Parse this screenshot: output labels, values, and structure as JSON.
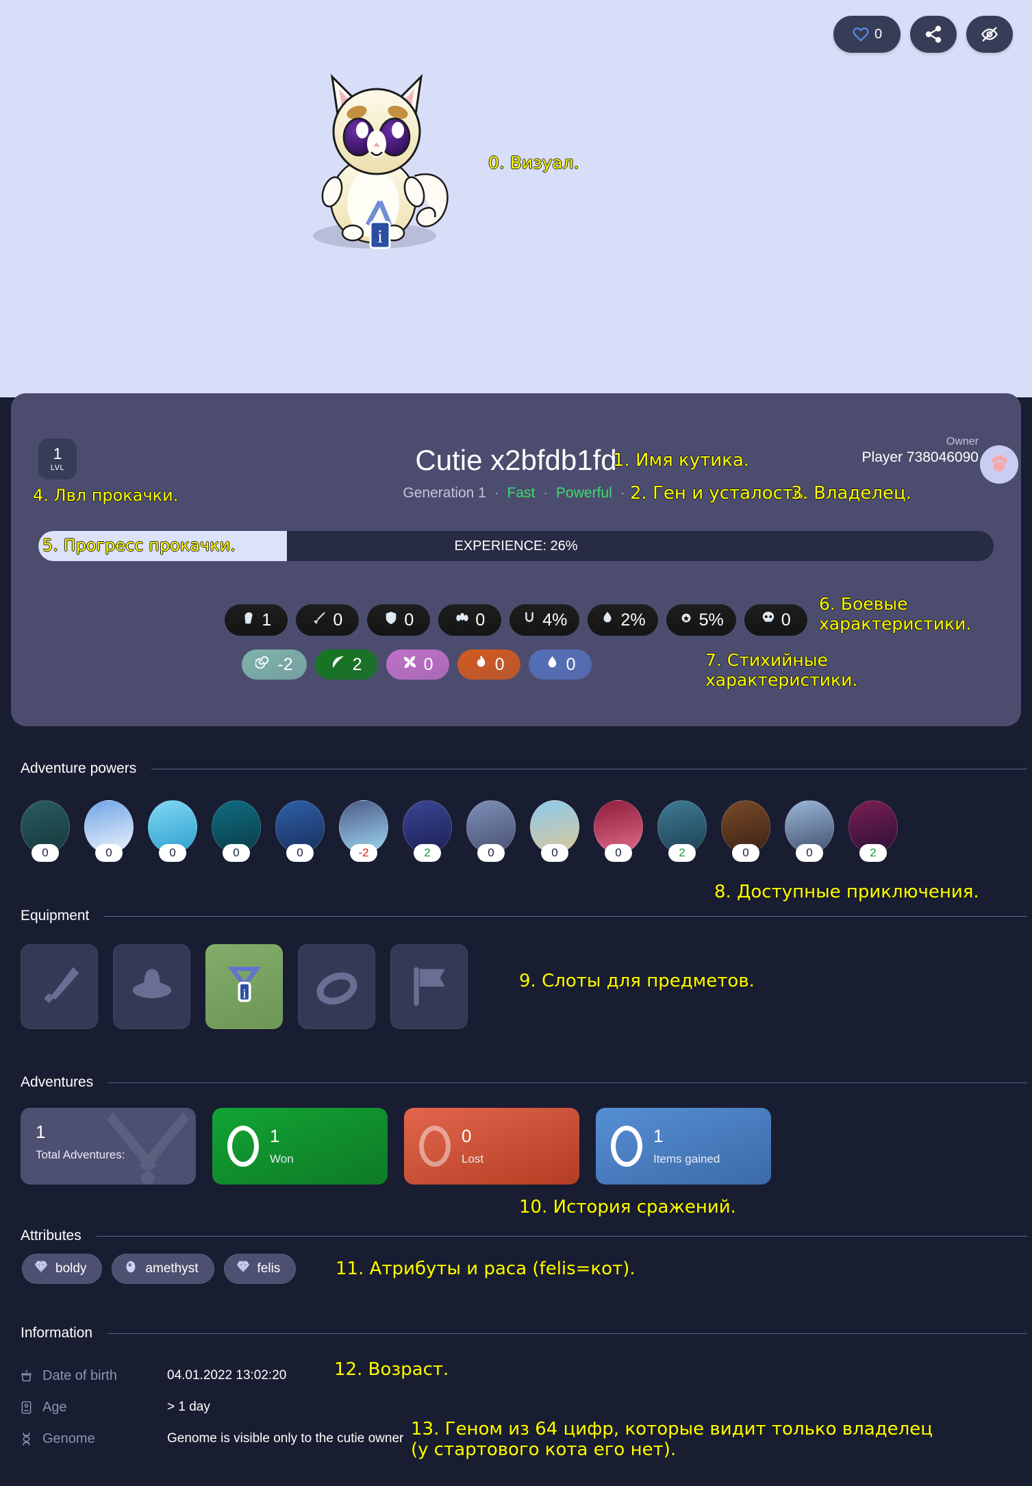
{
  "topbar": {
    "like_count": "0",
    "like_icon": "heart-icon",
    "share_icon": "share-icon",
    "hide_icon": "eye-off-icon"
  },
  "hero": {
    "visual_annotation": "0. Визуал.",
    "avatar_name": "cutie-cat-avatar"
  },
  "profile": {
    "level_value": "1",
    "level_label": "LVL",
    "title": "Cutie x2bfdb1fd",
    "generation": "Generation 1",
    "trait_speed": "Fast",
    "trait_power": "Powerful",
    "separator": "·",
    "owner_label": "Owner",
    "owner_name": "Player 738046090",
    "owner_avatar_icon": "paw-icon",
    "experience_label": "EXPERIENCE: 26%",
    "experience_percent": 26
  },
  "battle_stats": [
    {
      "icon": "fist-icon",
      "value": "1"
    },
    {
      "icon": "sword-icon",
      "value": "0"
    },
    {
      "icon": "shield-icon",
      "value": "0"
    },
    {
      "icon": "paws-icon",
      "value": "0"
    },
    {
      "icon": "horseshoe-icon",
      "value": "4%"
    },
    {
      "icon": "potion-icon",
      "value": "2%"
    },
    {
      "icon": "medal-icon",
      "value": "5%"
    },
    {
      "icon": "skull-icon",
      "value": "0"
    }
  ],
  "elemental_stats": [
    {
      "icon": "spiral-icon",
      "value": "-2",
      "color": "#7fb3ac"
    },
    {
      "icon": "leaf-icon",
      "value": "2",
      "color": "#14761f"
    },
    {
      "icon": "wind-icon",
      "value": "0",
      "color": "#c070c8"
    },
    {
      "icon": "fire-icon",
      "value": "0",
      "color": "#d35a20"
    },
    {
      "icon": "water-icon",
      "value": "0",
      "color": "#5570b9"
    }
  ],
  "sections": {
    "adventure_powers": "Adventure powers",
    "equipment": "Equipment",
    "adventures": "Adventures",
    "attributes": "Attributes",
    "information": "Information"
  },
  "adventure_powers": [
    {
      "name": "cave",
      "value": "0",
      "c1": "#2c5b5e",
      "c2": "#14393d"
    },
    {
      "name": "snowfield",
      "value": "0",
      "c1": "#6ea5e8",
      "c2": "#eef2fa"
    },
    {
      "name": "icy-mountains",
      "value": "0",
      "c1": "#7fd8f2",
      "c2": "#2f9fd0"
    },
    {
      "name": "night-forest",
      "value": "0",
      "c1": "#0f6d80",
      "c2": "#0a3d4b"
    },
    {
      "name": "desert-night",
      "value": "0",
      "c1": "#2f5fa8",
      "c2": "#18305e"
    },
    {
      "name": "blizzard",
      "value": "-2",
      "c1": "#4b5b86",
      "c2": "#9fd6f2"
    },
    {
      "name": "starry-city",
      "value": "2",
      "c1": "#3b4693",
      "c2": "#1c2057"
    },
    {
      "name": "graffiti-wall",
      "value": "0",
      "c1": "#7d8fb6",
      "c2": "#4a5175"
    },
    {
      "name": "tropical-beach",
      "value": "0",
      "c1": "#8cc9ee",
      "c2": "#d9c79a"
    },
    {
      "name": "crimson-canyon",
      "value": "0",
      "c1": "#8b1d39",
      "c2": "#e26a8c"
    },
    {
      "name": "snowy-street",
      "value": "2",
      "c1": "#3f7a93",
      "c2": "#1c4255"
    },
    {
      "name": "christmas-tree",
      "value": "0",
      "c1": "#7a4a2a",
      "c2": "#3b2214"
    },
    {
      "name": "neon-city",
      "value": "0",
      "c1": "#9bb6d8",
      "c2": "#42526e"
    },
    {
      "name": "purple-dusk",
      "value": "2",
      "c1": "#7a1f52",
      "c2": "#2c1038"
    }
  ],
  "equipment": [
    {
      "slot": "weapon",
      "icon": "sword-icon",
      "filled": false
    },
    {
      "slot": "head",
      "icon": "hat-icon",
      "filled": false
    },
    {
      "slot": "neck",
      "icon": "medal-icon",
      "filled": true
    },
    {
      "slot": "ring",
      "icon": "ring-icon",
      "filled": false
    },
    {
      "slot": "banner",
      "icon": "flag-icon",
      "filled": false
    }
  ],
  "adventures": [
    {
      "key": "total",
      "value": "1",
      "label": "Total Adventures:"
    },
    {
      "key": "won",
      "value": "1",
      "label": "Won"
    },
    {
      "key": "lost",
      "value": "0",
      "label": "Lost"
    },
    {
      "key": "items",
      "value": "1",
      "label": "Items gained"
    }
  ],
  "attributes": [
    {
      "label": "boldy",
      "icon": "gem-icon"
    },
    {
      "label": "amethyst",
      "icon": "stone-icon"
    },
    {
      "label": "felis",
      "icon": "gem-icon"
    }
  ],
  "information": [
    {
      "icon": "cupcake-icon",
      "key": "Date of birth",
      "value": "04.01.2022 13:02:20"
    },
    {
      "icon": "id-card-icon",
      "key": "Age",
      "value": "> 1 day"
    },
    {
      "icon": "dna-icon",
      "key": "Genome",
      "value": "Genome is visible only to the cutie owner"
    }
  ],
  "annotations": {
    "a0": "0. Визуал.",
    "a1": "1. Имя кутика.",
    "a2": "2. Ген и усталость.",
    "a3": "3. Владелец.",
    "a4": "4. Лвл прокачки.",
    "a5": "5. Прогресс прокачки.",
    "a6": "6. Боевые\nхарактеристики.",
    "a7": "7. Стихийные\nхарактеристики.",
    "a8": "8. Доступные приключения.",
    "a9": "9. Слоты для предметов.",
    "a10": "10. История сражений.",
    "a11": "11. Атрибуты и раса (felis=кот).",
    "a12": "12. Возраст.",
    "a13": "13. Геном из 64 цифр, которые видит только владелец\n(у стартового кота его нет)."
  },
  "colors": {
    "hero_bg": "#d9deF8",
    "page_bg": "#191d31",
    "card_bg": "#4c4d6e",
    "accent_yellow": "#ffff00",
    "green": "#3ddc6d"
  }
}
